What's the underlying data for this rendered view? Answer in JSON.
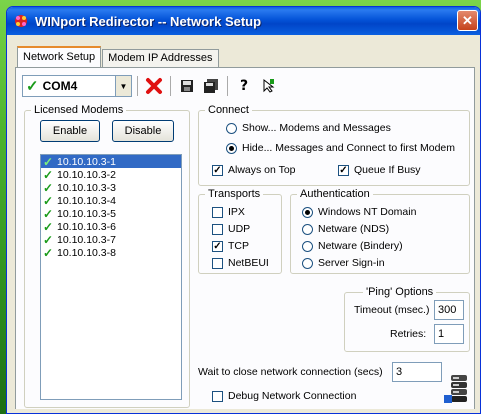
{
  "window": {
    "title": "WINport Redirector -- Network Setup",
    "close_glyph": "✕"
  },
  "tabs": [
    {
      "label": "Network Setup",
      "active": true
    },
    {
      "label": "Modem IP Addresses",
      "active": false
    }
  ],
  "toolbar": {
    "com_port": "COM4"
  },
  "licensed_modems": {
    "title": "Licensed Modems",
    "enable_label": "Enable",
    "disable_label": "Disable",
    "items": [
      "10.10.10.3-1",
      "10.10.10.3-2",
      "10.10.10.3-3",
      "10.10.10.3-4",
      "10.10.10.3-5",
      "10.10.10.3-6",
      "10.10.10.3-7",
      "10.10.10.3-8"
    ]
  },
  "connect": {
    "title": "Connect",
    "show_label": "Show...  Modems and Messages",
    "hide_label": "Hide...  Messages and Connect to first Modem",
    "always_on_top_label": "Always on Top",
    "queue_if_busy_label": "Queue If Busy"
  },
  "transports": {
    "title": "Transports",
    "ipx": "IPX",
    "udp": "UDP",
    "tcp": "TCP",
    "netbeui": "NetBEUI"
  },
  "authentication": {
    "title": "Authentication",
    "nt_domain": "Windows NT Domain",
    "nds": "Netware (NDS)",
    "bindery": "Netware (Bindery)",
    "server_signin": "Server Sign-in"
  },
  "ping": {
    "title": "'Ping' Options",
    "timeout_label": "Timeout (msec.)",
    "timeout_value": "300",
    "retries_label": "Retries:",
    "retries_value": "1"
  },
  "wait_close": {
    "label": "Wait to close network connection (secs)",
    "value": "3"
  },
  "debug": {
    "label": "Debug Network Connection"
  },
  "colors": {
    "title_bar": "#0453d8",
    "check_green": "#1a9b1a",
    "selection": "#316ac5",
    "desktop_green": "#4fb52f"
  },
  "icons": [
    "app-icon",
    "combo-check-icon",
    "delete-icon",
    "save-icon",
    "save-all-icon",
    "help-icon",
    "info-icon",
    "network-server-icon"
  ]
}
